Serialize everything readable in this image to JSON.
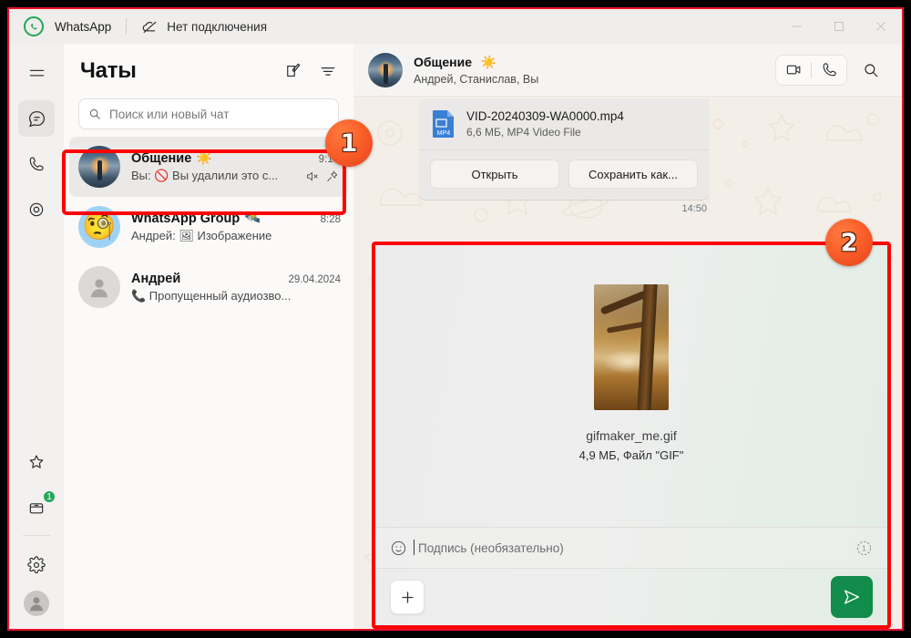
{
  "titlebar": {
    "app_name": "WhatsApp",
    "connection_status": "Нет подключения",
    "logo_icon": "whatsapp-logo-icon",
    "connection_icon": "cloud-offline-icon",
    "minimize_icon": "minimize-icon",
    "maximize_icon": "maximize-icon",
    "close_icon": "close-icon"
  },
  "rail": {
    "items": [
      {
        "name": "menu",
        "icon": "hamburger-menu-icon"
      },
      {
        "name": "chats",
        "icon": "chat-bubble-icon",
        "active": true
      },
      {
        "name": "calls",
        "icon": "phone-icon"
      },
      {
        "name": "status",
        "icon": "status-circles-icon"
      }
    ],
    "bottom": [
      {
        "name": "starred",
        "icon": "star-icon"
      },
      {
        "name": "archived",
        "icon": "archive-box-icon",
        "badge": "1"
      },
      {
        "name": "settings",
        "icon": "gear-icon"
      },
      {
        "name": "profile",
        "icon": "avatar-icon"
      }
    ]
  },
  "chat_list": {
    "title": "Чаты",
    "new_chat_icon": "new-chat-pencil-icon",
    "filter_icon": "filter-icon",
    "search": {
      "placeholder": "Поиск или новый чат",
      "icon": "search-icon",
      "value": ""
    },
    "items": [
      {
        "name": "Общение",
        "name_emoji": "☀️",
        "time": "9:15",
        "preview": "Вы: 🚫 Вы удалили это с...",
        "avatar": "sunset-lake-photo",
        "muted_icon": "speaker-muted-icon",
        "pinned_icon": "pin-icon",
        "selected": true
      },
      {
        "name": "WhatsApp Group",
        "name_emoji": "🛰️",
        "time": "8:28",
        "preview": "Андрей: 🖼 Изображение",
        "avatar": "monocle-emoji",
        "selected": false
      },
      {
        "name": "Андрей",
        "name_emoji": "",
        "time": "29.04.2024",
        "preview": "📞 Пропущенный аудиозво...",
        "avatar": "default-person",
        "selected": false
      }
    ]
  },
  "conversation": {
    "title": "Общение",
    "title_emoji": "☀️",
    "subtitle": "Андрей, Станислав, Вы",
    "avatar": "sunset-lake-photo",
    "video_call_icon": "video-camera-icon",
    "voice_call_icon": "phone-icon",
    "search_icon": "search-icon",
    "message": {
      "file_name": "VID-20240309-WA0000.mp4",
      "file_meta": "6,6 МБ, MP4 Video File",
      "file_icon": "mp4-file-icon",
      "file_icon_label": "MP4",
      "open_label": "Открыть",
      "save_label": "Сохранить как...",
      "time": "14:50"
    }
  },
  "file_preview": {
    "file_name": "gifmaker_me.gif",
    "file_meta": "4,9 МБ, Файл \"GIF\"",
    "thumbnail": "autumn-tree-photo",
    "caption": {
      "placeholder": "Подпись (необязательно)",
      "value": "",
      "emoji_icon": "emoji-smiley-icon",
      "view_once_icon": "view-once-icon",
      "view_once_label": "1"
    },
    "add_icon": "plus-icon",
    "send_icon": "send-paper-plane-icon"
  },
  "annotations": {
    "color": "#ff0000",
    "badges": [
      {
        "label": "1",
        "target": "selected-chat-item"
      },
      {
        "label": "2",
        "target": "file-preview-overlay"
      }
    ]
  }
}
